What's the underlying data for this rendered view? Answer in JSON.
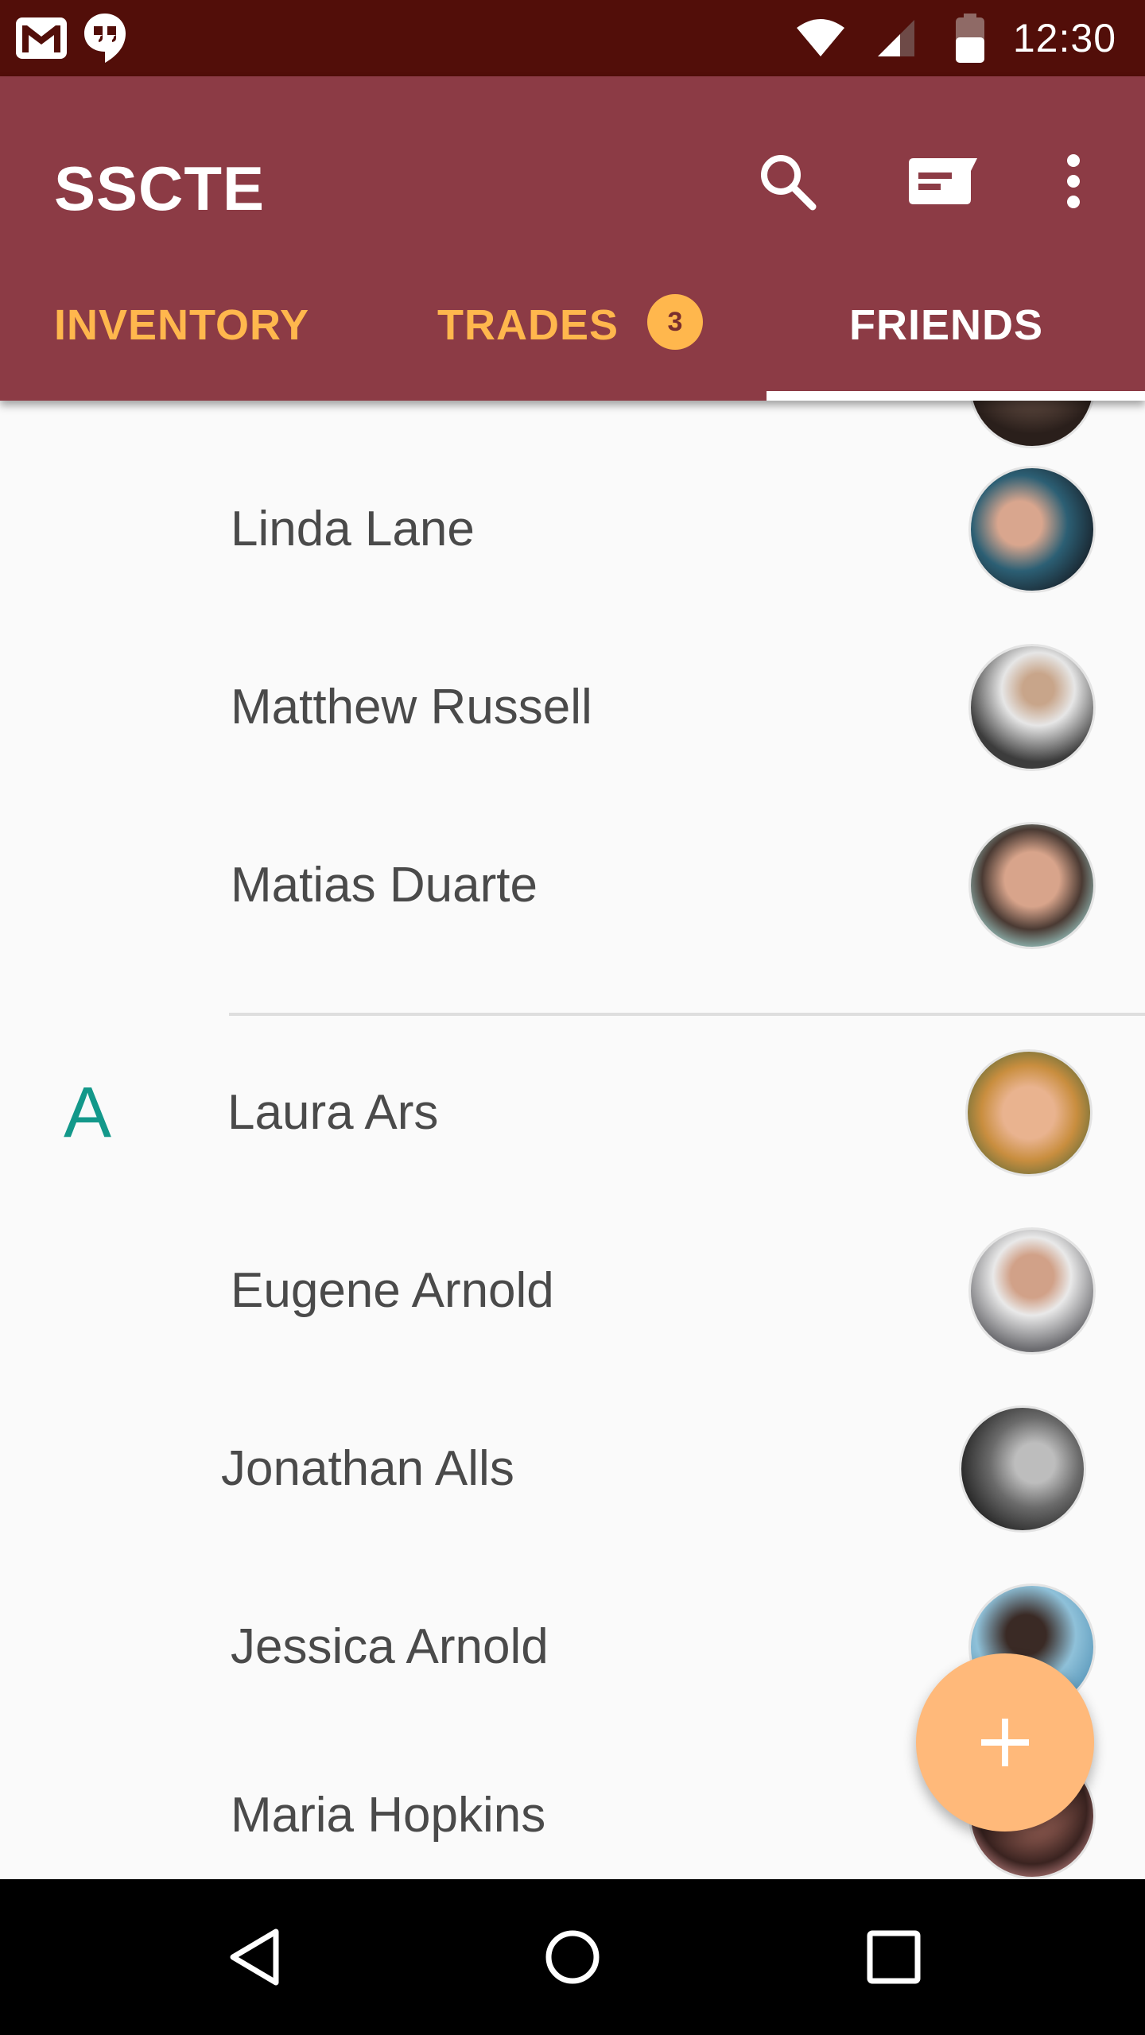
{
  "status_bar": {
    "time": "12:30",
    "left_icons": [
      "gmail-icon",
      "hangouts-icon"
    ],
    "right_icons": [
      "wifi-icon",
      "cell-signal-icon",
      "battery-icon"
    ]
  },
  "app_bar": {
    "title": "SSCTE",
    "actions": [
      "search-icon",
      "message-icon",
      "more-vert-icon"
    ]
  },
  "tabs": [
    {
      "label": "INVENTORY",
      "active": false
    },
    {
      "label": "TRADES",
      "active": false,
      "badge": "3"
    },
    {
      "label": "FRIENDS",
      "active": true
    }
  ],
  "colors": {
    "status_bar": "#520e09",
    "app_bar": "#8c3b45",
    "tab_inactive": "#ffb74d",
    "section_letter": "#13988a",
    "fab": "#ffb97a"
  },
  "friends": [
    {
      "name": "Linda Lane",
      "section": ""
    },
    {
      "name": "Matthew Russell",
      "section": ""
    },
    {
      "name": "Matias Duarte",
      "section": ""
    },
    {
      "name": "Laura Ars",
      "section": "A"
    },
    {
      "name": "Eugene Arnold",
      "section": ""
    },
    {
      "name": "Jonathan Alls",
      "section": ""
    },
    {
      "name": "Jessica Arnold",
      "section": ""
    },
    {
      "name": "Maria Hopkins",
      "section": ""
    }
  ],
  "fab": {
    "icon": "plus-icon"
  },
  "nav_bar": {
    "buttons": [
      "back-icon",
      "home-icon",
      "recents-icon"
    ]
  }
}
